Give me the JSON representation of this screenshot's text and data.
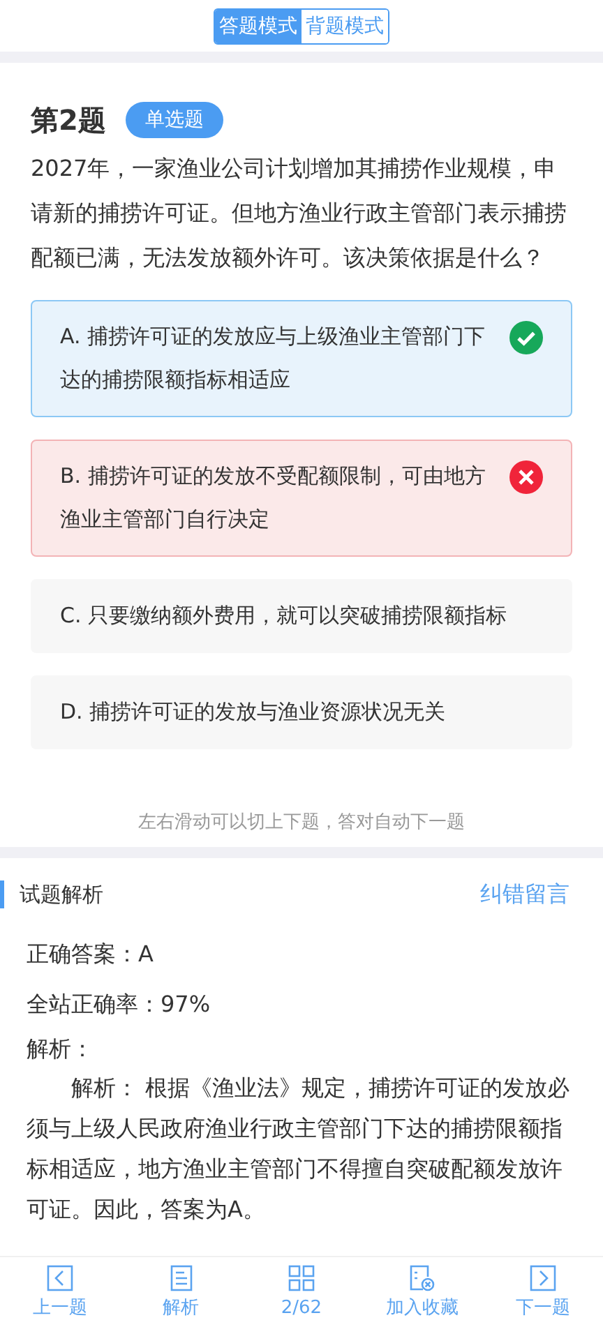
{
  "modes": [
    {
      "label": "答题模式",
      "selected": true
    },
    {
      "label": "背题模式",
      "selected": false
    }
  ],
  "question": {
    "number": "第2题",
    "type": "单选题",
    "text": "2027年，一家渔业公司计划增加其捕捞作业规模，申请新的捕捞许可证。但地方渔业行政主管部门表示捕捞配额已满，无法发放额外许可。该决策依据是什么？",
    "options": [
      {
        "text": "A. 捕捞许可证的发放应与上级渔业主管部门下达的捕捞限额指标相适应",
        "correct": true,
        "wrong": false
      },
      {
        "text": "B. 捕捞许可证的发放不受配额限制，可由地方渔业主管部门自行决定",
        "correct": false,
        "wrong": true
      },
      {
        "text": "C. 只要缴纳额外费用，就可以突破捕捞限额指标",
        "correct": false,
        "wrong": false
      },
      {
        "text": "D. 捕捞许可证的发放与渔业资源状况无关",
        "correct": false,
        "wrong": false
      }
    ]
  },
  "hint": "左右滑动可以切上下题，答对自动下一题",
  "analysis": {
    "title": "试题解析",
    "feedback": "纠错留言",
    "answer": "正确答案：A",
    "rate": "全站正确率：97%",
    "label": "解析：",
    "body": "解析： 根据《渔业法》规定，捕捞许可证的发放必须与上级人民政府渔业行政主管部门下达的捕捞限额指标相适应，地方渔业主管部门不得擅自突破配额发放许可证。因此，答案为A。"
  },
  "nav": [
    {
      "label": "上一题",
      "kind": "prev"
    },
    {
      "label": "解析",
      "kind": "doc"
    },
    {
      "label": "2/62",
      "kind": "grid"
    },
    {
      "label": "加入收藏",
      "kind": "fav"
    },
    {
      "label": "下一题",
      "kind": "next"
    }
  ]
}
